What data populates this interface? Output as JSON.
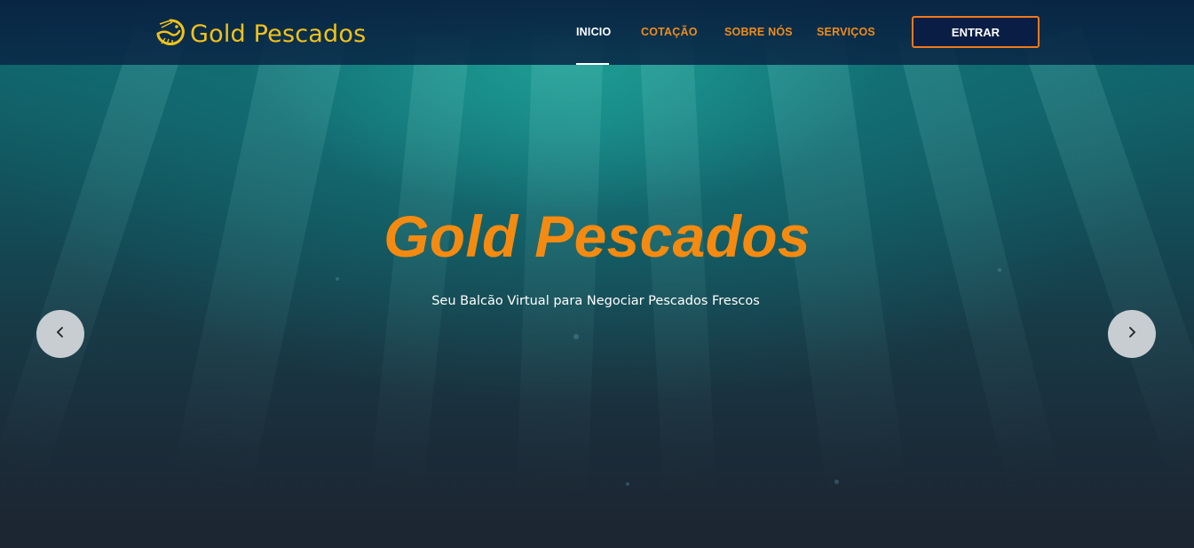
{
  "brand": {
    "name": "Gold Pescados",
    "logo_icon": "shrimp-icon"
  },
  "nav": {
    "items": [
      {
        "label": "INICIO",
        "active": true
      },
      {
        "label": "COTAÇÃO",
        "active": false
      },
      {
        "label": "SOBRE NÓS",
        "active": false
      },
      {
        "label": "SERVIÇOS",
        "active": false
      }
    ],
    "login_button": "ENTRAR"
  },
  "hero": {
    "title": "Gold Pescados",
    "subtitle": "Seu Balcão Virtual para Negociar Pescados Frescos",
    "prev_icon": "chevron-left-icon",
    "next_icon": "chevron-right-icon"
  },
  "colors": {
    "accent": "#f58a10",
    "brand_gold": "#f2c21a",
    "navbar": "#082040",
    "button_border": "#f07a1a",
    "carousel_button": "#c7cdd1"
  }
}
